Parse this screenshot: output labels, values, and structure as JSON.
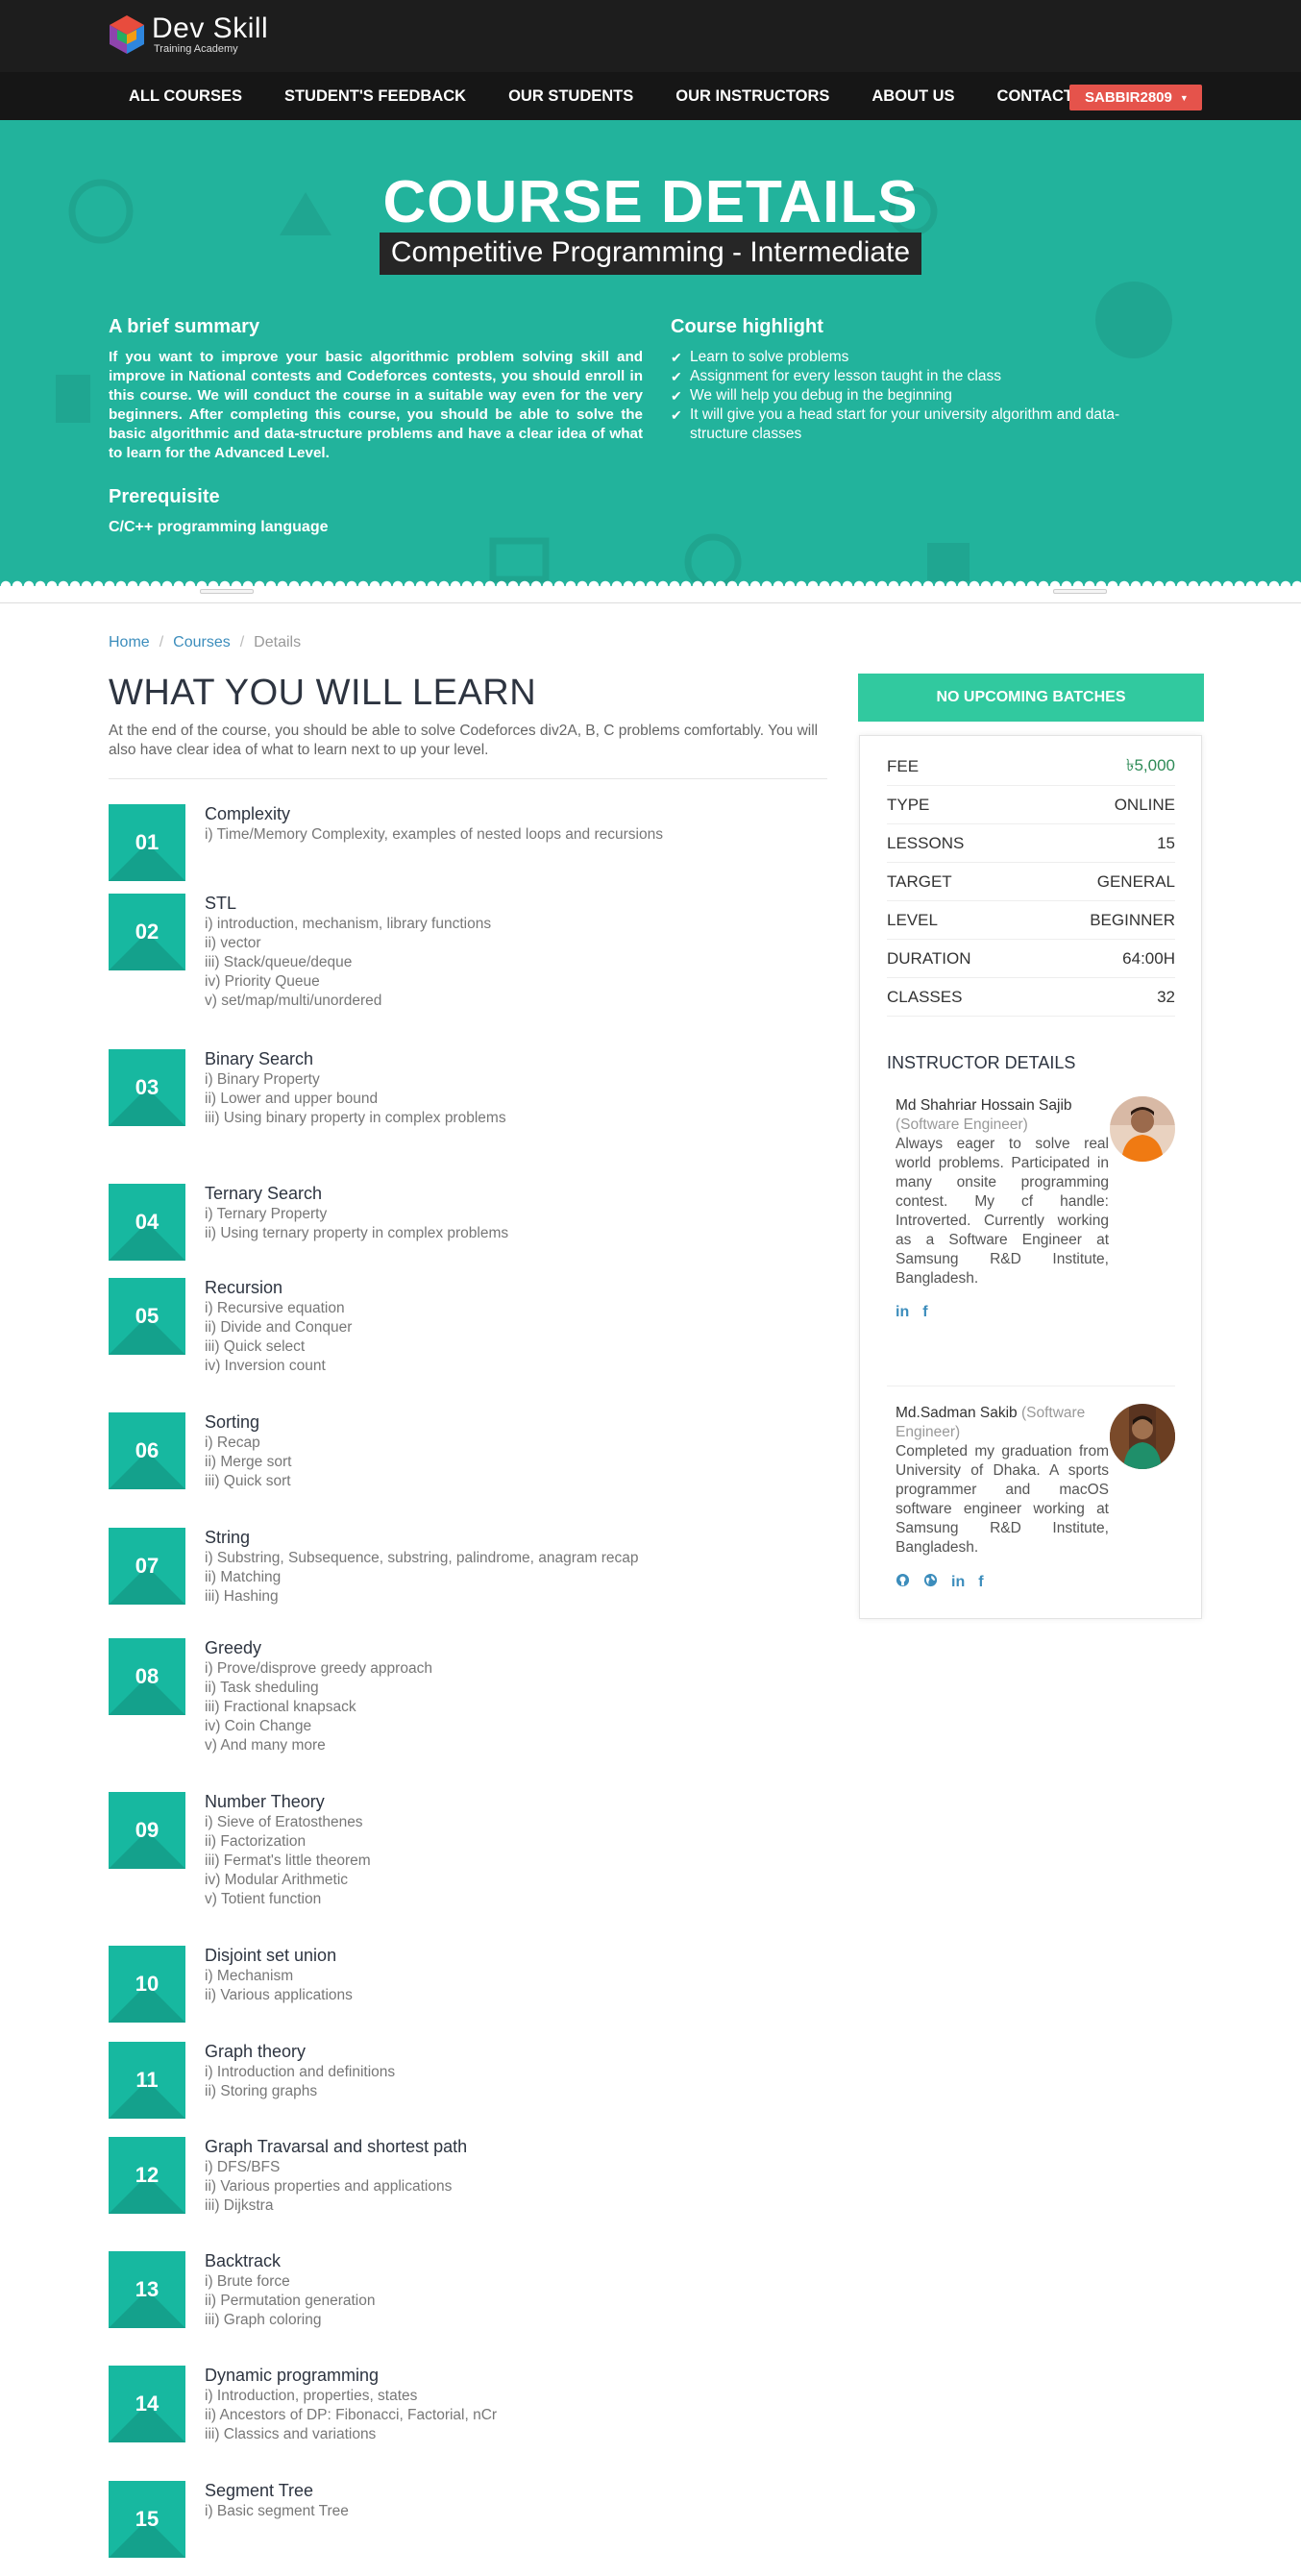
{
  "logo": {
    "title": "Dev Skill",
    "subtitle": "Training Academy"
  },
  "nav": {
    "items": [
      "ALL COURSES",
      "STUDENT'S FEEDBACK",
      "OUR STUDENTS",
      "OUR INSTRUCTORS",
      "ABOUT US",
      "CONTACTS"
    ],
    "user": "SABBIR2809"
  },
  "hero": {
    "title": "COURSE DETAILS",
    "subtitle": "Competitive Programming - Intermediate",
    "summary_heading": "A brief summary",
    "summary_text": "If you want to improve your basic algorithmic problem solving skill and improve in National contests and Codeforces contests, you should enroll in this course. We will conduct the course in a suitable way even for the very beginners. After completing this course, you should be able to solve the basic algorithmic and data-structure problems and have a clear idea of what to learn for the Advanced Level.",
    "prereq_heading": "Prerequisite",
    "prereq_text": "C/C++ programming language",
    "highlight_heading": "Course highlight",
    "highlights": [
      "Learn to solve problems",
      "Assignment for every lesson taught in the class",
      "We will help you debug in the beginning",
      "It will give you a head start for your university algorithm and data-structure classes"
    ]
  },
  "breadcrumb": [
    "Home",
    "Courses",
    "Details"
  ],
  "learn": {
    "title": "WHAT YOU WILL LEARN",
    "description": "At the end of the course, you should be able to solve Codeforces div2A, B, C problems comfortably. You will also have clear idea of what to learn next to up your level."
  },
  "topics": [
    {
      "num": "01",
      "title": "Complexity",
      "items": [
        "i) Time/Memory Complexity, examples of nested loops and recursions"
      ]
    },
    {
      "num": "02",
      "title": "STL",
      "items": [
        "i) introduction, mechanism, library functions",
        "ii) vector",
        "iii) Stack/queue/deque",
        "iv) Priority Queue",
        "v) set/map/multi/unordered"
      ]
    },
    {
      "num": "03",
      "title": "Binary Search",
      "items": [
        "i) Binary Property",
        "ii) Lower and upper bound",
        "iii) Using binary property in complex problems"
      ]
    },
    {
      "num": "04",
      "title": "Ternary Search",
      "items": [
        "i) Ternary Property",
        "ii) Using ternary property in complex problems"
      ]
    },
    {
      "num": "05",
      "title": "Recursion",
      "items": [
        "i) Recursive equation",
        "ii) Divide and Conquer",
        "iii) Quick select",
        "iv) Inversion count"
      ]
    },
    {
      "num": "06",
      "title": "Sorting",
      "items": [
        "i) Recap",
        "ii) Merge sort",
        "iii) Quick sort"
      ]
    },
    {
      "num": "07",
      "title": "String",
      "items": [
        "i) Substring, Subsequence, substring, palindrome, anagram recap",
        "ii) Matching",
        "iii) Hashing"
      ]
    },
    {
      "num": "08",
      "title": "Greedy",
      "items": [
        "i) Prove/disprove greedy approach",
        "ii) Task sheduling",
        "iii) Fractional knapsack",
        "iv) Coin Change",
        "v) And many more"
      ]
    },
    {
      "num": "09",
      "title": "Number Theory",
      "items": [
        "i) Sieve of Eratosthenes",
        "ii) Factorization",
        "iii) Fermat's little theorem",
        "iv) Modular Arithmetic",
        "v) Totient function"
      ]
    },
    {
      "num": "10",
      "title": "Disjoint set union",
      "items": [
        "i) Mechanism",
        "ii) Various applications"
      ]
    },
    {
      "num": "11",
      "title": "Graph theory",
      "items": [
        "i) Introduction and definitions",
        "ii) Storing graphs"
      ]
    },
    {
      "num": "12",
      "title": "Graph Travarsal and shortest path",
      "items": [
        "i) DFS/BFS",
        "ii) Various properties and applications",
        "iii) Dijkstra"
      ]
    },
    {
      "num": "13",
      "title": "Backtrack",
      "items": [
        "i) Brute force",
        "ii) Permutation generation",
        "iii) Graph coloring"
      ]
    },
    {
      "num": "14",
      "title": "Dynamic programming",
      "items": [
        "i) Introduction, properties, states",
        "ii) Ancestors of DP: Fibonacci, Factorial, nCr",
        "iii) Classics and variations"
      ]
    },
    {
      "num": "15",
      "title": "Segment Tree",
      "items": [
        "i) Basic segment Tree"
      ]
    }
  ],
  "sidebar": {
    "batch_button": "NO UPCOMING BATCHES",
    "info": [
      {
        "label": "FEE",
        "value": "৳5,000"
      },
      {
        "label": "TYPE",
        "value": "ONLINE"
      },
      {
        "label": "LESSONS",
        "value": "15"
      },
      {
        "label": "TARGET",
        "value": "GENERAL"
      },
      {
        "label": "LEVEL",
        "value": "BEGINNER"
      },
      {
        "label": "DURATION",
        "value": "64:00H"
      },
      {
        "label": "CLASSES",
        "value": "32"
      }
    ],
    "instructor_heading": "INSTRUCTOR DETAILS",
    "instructors": [
      {
        "name": "Md Shahriar Hossain Sajib",
        "role": "(Software Engineer)",
        "bio": "Always eager to solve real world problems. Participated in many onsite programming contest. My cf handle: Introverted. Currently working as a Software Engineer at Samsung R&D Institute, Bangladesh.",
        "socials": [
          "linkedin-icon",
          "facebook-icon"
        ]
      },
      {
        "name": "Md.Sadman Sakib",
        "role": "(Software Engineer)",
        "bio": "Completed my graduation from University of Dhaka. A sports programmer and macOS software engineer working at Samsung R&D Institute, Bangladesh.",
        "socials": [
          "github-icon",
          "globe-icon",
          "linkedin-icon",
          "facebook-icon"
        ]
      }
    ]
  }
}
